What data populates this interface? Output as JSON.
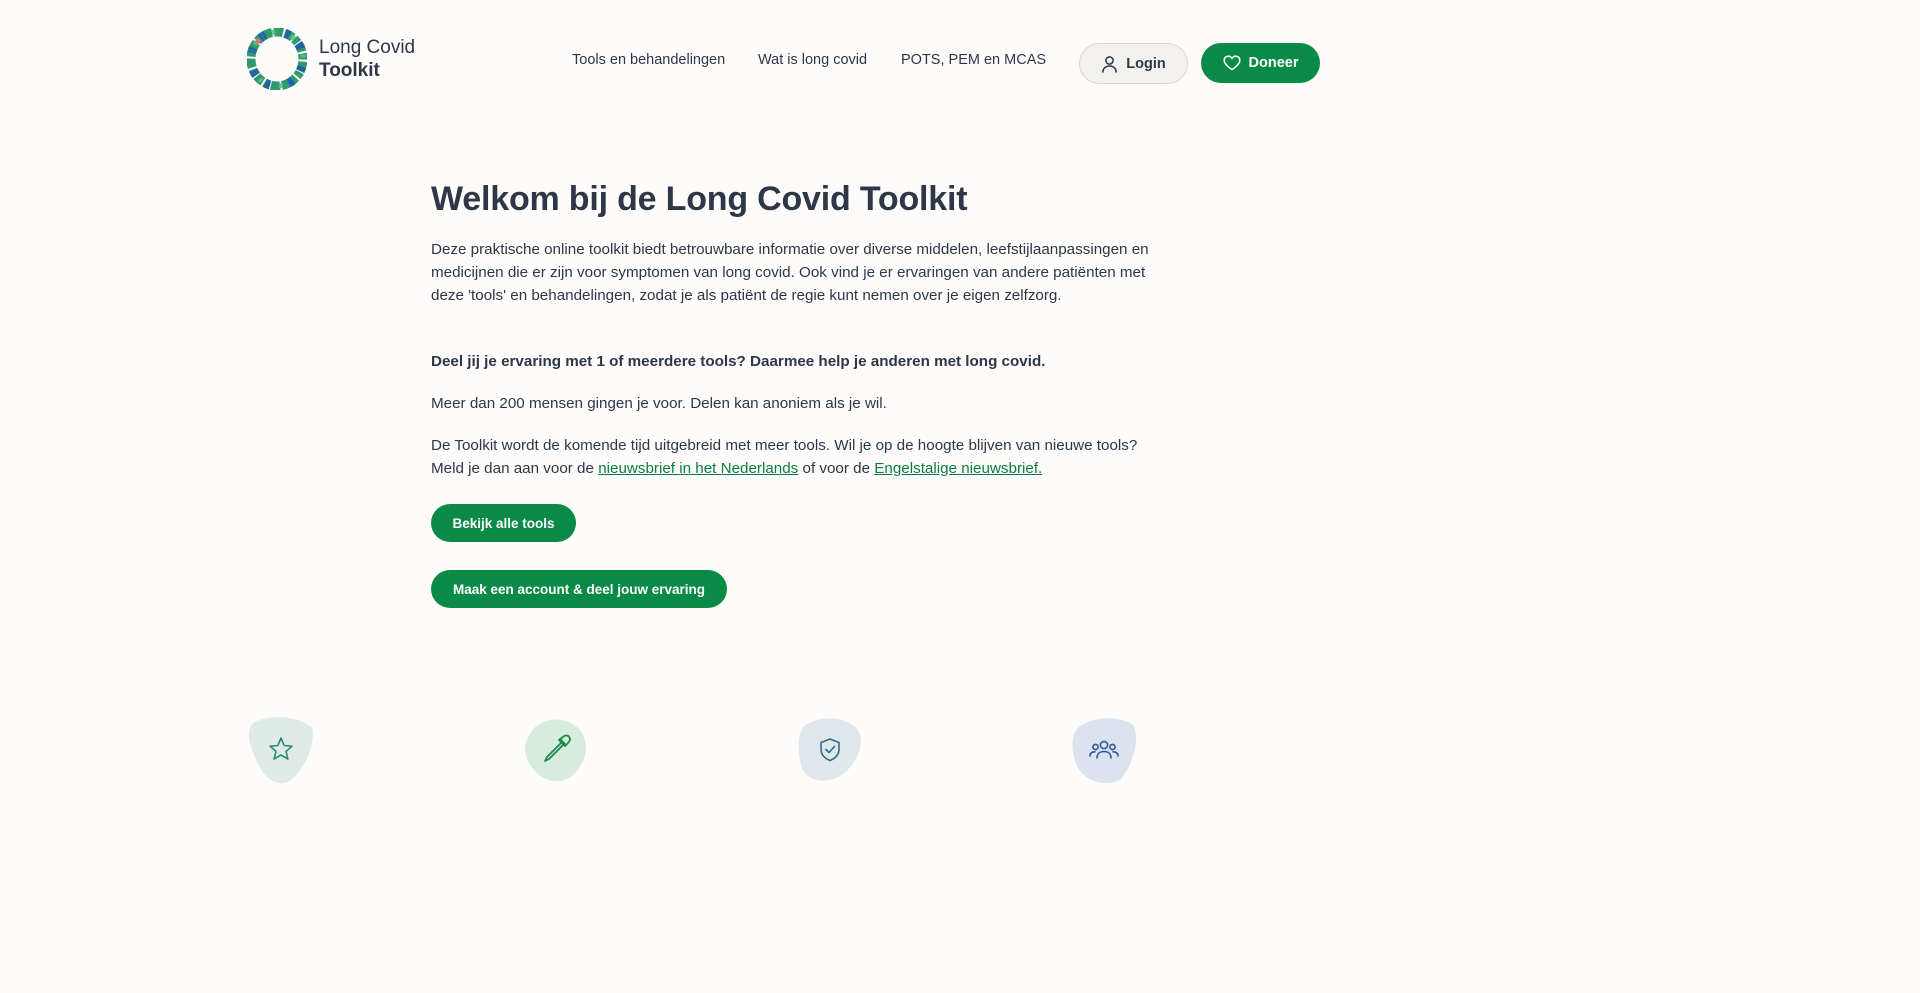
{
  "brand": {
    "name_line1": "Long Covid",
    "name_line2": "Toolkit"
  },
  "nav": {
    "items": [
      {
        "label": "Tools en behandelingen"
      },
      {
        "label": "Wat is long covid"
      },
      {
        "label": "POTS, PEM en MCAS"
      }
    ]
  },
  "header_actions": {
    "login_label": "Login",
    "donate_label": "Doneer"
  },
  "hero": {
    "title": "Welkom bij de Long Covid Toolkit",
    "intro": "Deze praktische online toolkit biedt betrouwbare informatie over diverse middelen, leefstijlaanpassingen en medicijnen die er zijn voor symptomen van long covid. Ook vind je er ervaringen van andere patiënten met deze 'tools' en behandelingen, zodat je als patiënt de regie kunt nemen over je eigen zelfzorg.",
    "share_prompt": "Deel jij je ervaring met 1 of meerdere tools? Daarmee help je anderen met long covid.",
    "social_proof": "Meer dan 200 mensen gingen je voor. Delen kan anoniem als je wil.",
    "newsletter_text_before": "De Toolkit wordt de komende tijd uitgebreid met meer tools. Wil je op de hoogte blijven van nieuwe tools? Meld je dan aan voor de ",
    "newsletter_link_nl": "nieuwsbrief in het Nederlands",
    "newsletter_text_middle": " of voor de ",
    "newsletter_link_en": "Engelstalige nieuwsbrief. ",
    "cta_view_tools": "Bekijk alle tools",
    "cta_create_account": "Maak een account & deel jouw ervaring"
  },
  "features": [
    {
      "icon": "star-icon",
      "blob_color": "#e0ebe7",
      "icon_color": "#2f8a78"
    },
    {
      "icon": "pipette-icon",
      "blob_color": "#d7ebdf",
      "icon_color": "#1b8a47"
    },
    {
      "icon": "shield-check-icon",
      "blob_color": "#e0e7ea",
      "icon_color": "#2b6e8f"
    },
    {
      "icon": "users-icon",
      "blob_color": "#dde3ee",
      "icon_color": "#2d55a0"
    }
  ],
  "colors": {
    "accent": "#0a8a47",
    "text": "#2d3748",
    "background": "#fefcfa",
    "link": "#0a7d43"
  }
}
